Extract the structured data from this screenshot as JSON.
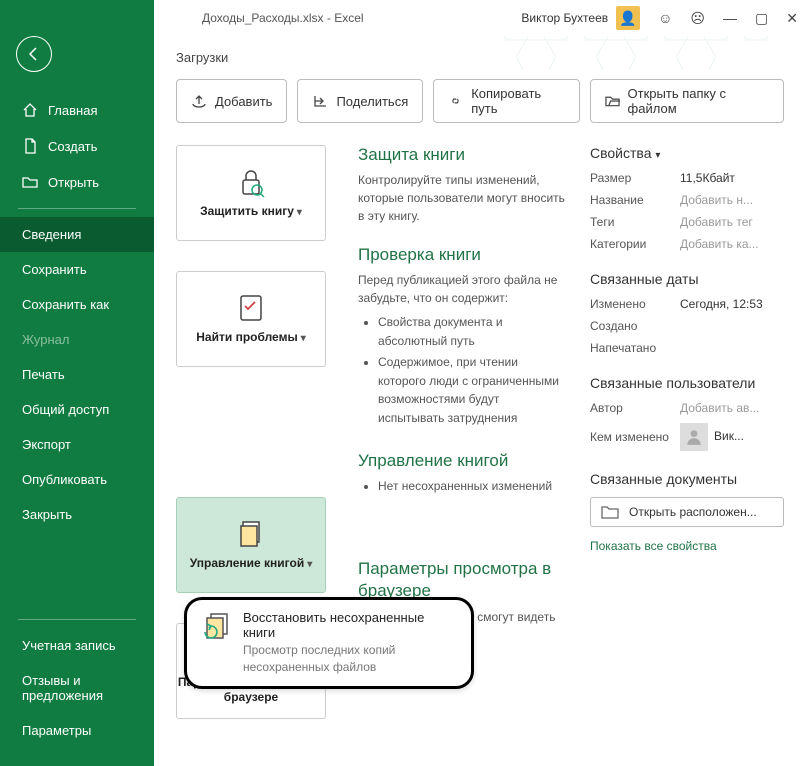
{
  "titlebar": {
    "document": "Доходы_Расходы.xlsx - Excel",
    "user": "Виктор Бухтеев"
  },
  "breadcrumb": "Загрузки",
  "sidebar": {
    "home": "Главная",
    "create": "Создать",
    "open": "Открыть",
    "info": "Сведения",
    "save": "Сохранить",
    "saveas": "Сохранить как",
    "history": "Журнал",
    "print": "Печать",
    "share": "Общий доступ",
    "export": "Экспорт",
    "publish": "Опубликовать",
    "close": "Закрыть",
    "account": "Учетная запись",
    "feedback": "Отзывы и предложения",
    "options": "Параметры"
  },
  "actions": {
    "add": "Добавить",
    "share": "Поделиться",
    "copypath": "Копировать путь",
    "openfolder": "Открыть папку с файлом"
  },
  "tiles": {
    "protect": "Защитить книгу",
    "inspect": "Найти проблемы",
    "manage": "Управление книгой",
    "browser": "Параметры просмотра в браузере"
  },
  "sections": {
    "protect": {
      "title": "Защита книги",
      "desc": "Контролируйте типы изменений, которые пользователи могут вносить в эту книгу."
    },
    "inspect": {
      "title": "Проверка книги",
      "desc": "Перед публикацией этого файла не забудьте, что он содержит:",
      "li1": "Свойства документа и абсолютный путь",
      "li2": "Содержимое, при чтении которого люди с ограниченными возможностями будут испытывать затруднения"
    },
    "manage": {
      "title": "Управление книгой",
      "li1": "Нет несохраненных изменений"
    },
    "browser": {
      "title": "Параметры просмотра в браузере",
      "desc": "Укажите, что именно смогут видеть пользователи при"
    }
  },
  "props": {
    "heading": "Свойства",
    "size_label": "Размер",
    "size": "11,5Кбайт",
    "title_label": "Название",
    "title_ph": "Добавить н...",
    "tags_label": "Теги",
    "tags_ph": "Добавить тег",
    "cat_label": "Категории",
    "cat_ph": "Добавить ка...",
    "dates_heading": "Связанные даты",
    "modified_label": "Изменено",
    "modified": "Сегодня, 12:53",
    "created_label": "Создано",
    "printed_label": "Напечатано",
    "users_heading": "Связанные пользователи",
    "author_label": "Автор",
    "author_ph": "Добавить ав...",
    "changedby_label": "Кем изменено",
    "changedby": "Вик...",
    "docs_heading": "Связанные документы",
    "openloc": "Открыть расположен...",
    "showall": "Показать все свойства"
  },
  "callout": {
    "title": "Восстановить несохраненные книги",
    "desc": "Просмотр последних копий несохраненных файлов"
  }
}
